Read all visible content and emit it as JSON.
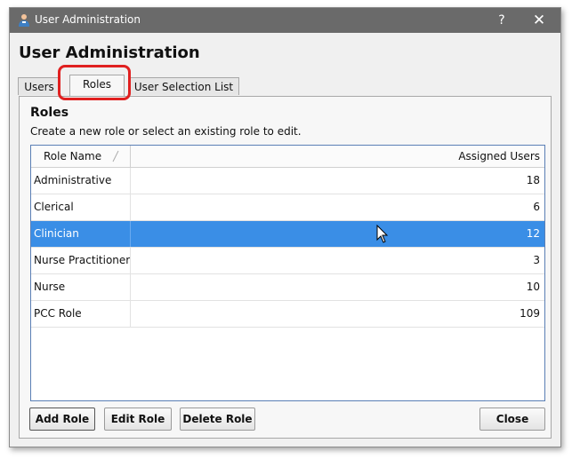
{
  "window": {
    "title": "User Administration",
    "help_label": "?",
    "close_label": "✕"
  },
  "page": {
    "heading": "User Administration"
  },
  "tabs": [
    {
      "label": "Users"
    },
    {
      "label": "Roles",
      "active": true
    },
    {
      "label": "User Selection List"
    }
  ],
  "roles": {
    "title": "Roles",
    "description": "Create a new role or select an existing role to edit.",
    "columns": {
      "name": "Role Name",
      "users": "Assigned Users"
    },
    "rows": [
      {
        "name": "Administrative",
        "users": "18"
      },
      {
        "name": "Clerical",
        "users": "6"
      },
      {
        "name": "Clinician",
        "users": "12",
        "selected": true
      },
      {
        "name": "Nurse Practitioner",
        "users": "3"
      },
      {
        "name": "Nurse",
        "users": "10"
      },
      {
        "name": "PCC Role",
        "users": "109"
      }
    ]
  },
  "buttons": {
    "add": "Add Role",
    "edit": "Edit Role",
    "delete": "Delete Role",
    "close": "Close"
  },
  "colors": {
    "selection": "#3a8ee6",
    "titlebar": "#6a6a6a",
    "highlight": "#e02020"
  }
}
